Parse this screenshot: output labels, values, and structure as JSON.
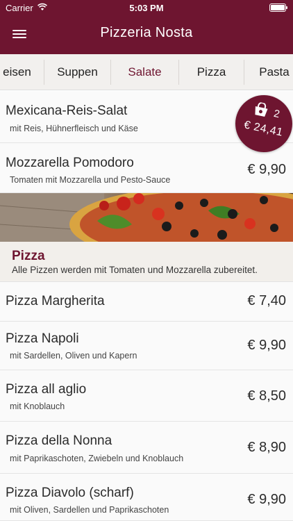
{
  "status": {
    "carrier": "Carrier",
    "time": "5:03 PM"
  },
  "header": {
    "title": "Pizzeria Nosta"
  },
  "tabs": [
    {
      "label": "eisen"
    },
    {
      "label": "Suppen"
    },
    {
      "label": "Salate",
      "active": true
    },
    {
      "label": "Pizza"
    },
    {
      "label": "Pasta"
    }
  ],
  "salads": [
    {
      "name": "Mexicana-Reis-Salat",
      "desc": "mit Reis, Hühnerfleisch und Käse",
      "price": ""
    },
    {
      "name": "Mozzarella Pomodoro",
      "desc": "Tomaten mit Mozzarella und Pesto-Sauce",
      "price": "€ 9,90"
    }
  ],
  "pizza_section": {
    "title": "Pizza",
    "subtitle": "Alle Pizzen werden mit Tomaten und Mozzarella zubereitet."
  },
  "pizzas": [
    {
      "name": "Pizza Margherita",
      "desc": "",
      "price": "€ 7,40"
    },
    {
      "name": "Pizza Napoli",
      "desc": "mit Sardellen, Oliven und Kapern",
      "price": "€ 9,90"
    },
    {
      "name": "Pizza all aglio",
      "desc": "mit Knoblauch",
      "price": "€ 8,50"
    },
    {
      "name": "Pizza della Nonna",
      "desc": "mit Paprikaschoten, Zwiebeln und Knoblauch",
      "price": "€ 8,90"
    },
    {
      "name": "Pizza Diavolo (scharf)",
      "desc": "mit Oliven, Sardellen und Paprikaschoten",
      "price": "€ 9,90"
    }
  ],
  "cart": {
    "count": "2",
    "total": "€ 24,41"
  },
  "colors": {
    "brand": "#6e1530",
    "tab_bg": "#f2f0ee",
    "section_bg": "#f2efeb"
  },
  "icons": {
    "menu": "hamburger-menu-icon",
    "cart": "shopping-bag-icon",
    "wifi": "wifi-icon",
    "battery": "battery-icon"
  }
}
